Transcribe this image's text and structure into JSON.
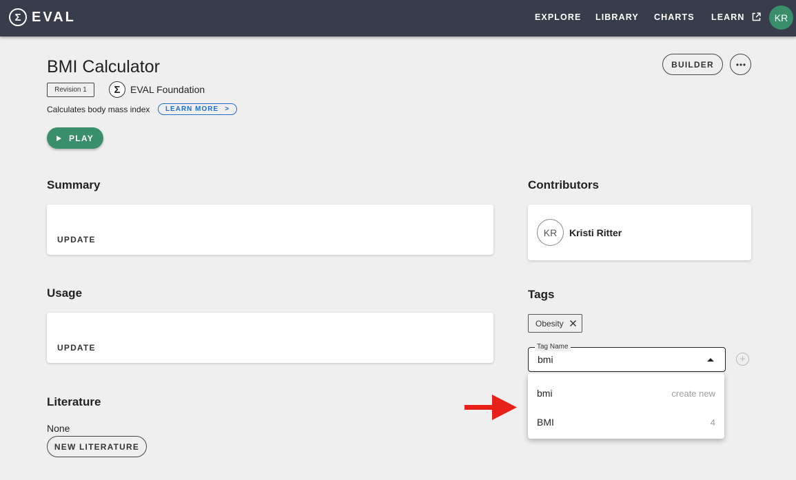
{
  "app": {
    "logo_symbol": "Σ",
    "name": "EVAL"
  },
  "nav": {
    "explore": "EXPLORE",
    "library": "LIBRARY",
    "charts": "CHARTS",
    "learn": "LEARN",
    "user_initials": "KR"
  },
  "header": {
    "title": "BMI Calculator",
    "revision": "Revision 1",
    "org_symbol": "Σ",
    "org_name": "EVAL Foundation",
    "description": "Calculates body mass index",
    "learn_more": "LEARN MORE",
    "learn_more_chevron": ">",
    "play": "PLAY",
    "builder": "BUILDER"
  },
  "summary": {
    "title": "Summary",
    "update": "UPDATE"
  },
  "usage": {
    "title": "Usage",
    "update": "UPDATE"
  },
  "literature": {
    "title": "Literature",
    "empty": "None",
    "new_button": "NEW LITERATURE"
  },
  "contributors": {
    "title": "Contributors",
    "items": [
      {
        "initials": "KR",
        "name": "Kristi Ritter"
      }
    ]
  },
  "tags": {
    "title": "Tags",
    "existing": [
      {
        "label": "Obesity"
      }
    ],
    "field_label": "Tag Name",
    "field_value": "bmi",
    "add_symbol": "+",
    "options": [
      {
        "label": "bmi",
        "meta": "create new"
      },
      {
        "label": "BMI",
        "meta": "4"
      }
    ]
  },
  "colors": {
    "topbar": "#383d4c",
    "accent_green": "#3a8f6b",
    "link_blue": "#1e6fd0",
    "annotation_arrow": "#e8201a"
  },
  "icons": {
    "nav_learn": "external-link-icon",
    "more": "more-horizontal-icon",
    "play": "play-icon",
    "tag_remove": "close-icon",
    "dropdown": "caret-up-icon",
    "add_tag": "add-circle-icon",
    "annotation": "red-arrow-icon"
  }
}
